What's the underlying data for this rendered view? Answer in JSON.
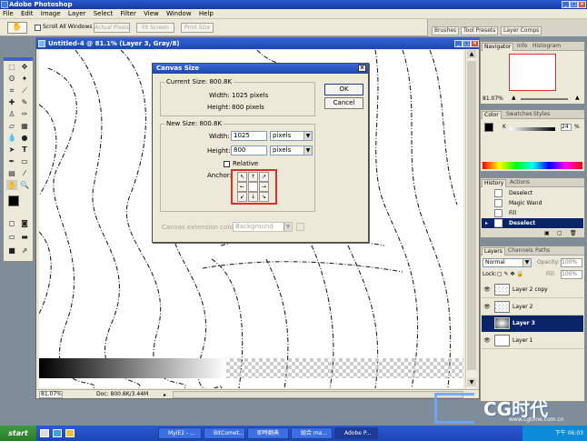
{
  "app": {
    "title": "Adobe Photoshop"
  },
  "menu": [
    "File",
    "Edit",
    "Image",
    "Layer",
    "Select",
    "Filter",
    "View",
    "Window",
    "Help"
  ],
  "options": {
    "scroll_all": "Scroll All Windows",
    "actual_pixels": "Actual Pixels",
    "fit_screen": "Fit Screen",
    "print_size": "Print Size",
    "well_tabs": [
      "Brushes",
      "Tool Presets",
      "Layer Comps"
    ]
  },
  "document": {
    "title": "Untitled-4 @ 81.1% (Layer 3, Gray/8)",
    "zoom": "81.07%",
    "doc_info": "Doc: 800.8K/3.44M"
  },
  "dialog": {
    "title": "Canvas Size",
    "current_size_label": "Current Size: 800.8K",
    "current_width_label": "Width:",
    "current_width_value": "1025 pixels",
    "current_height_label": "Height:",
    "current_height_value": "800 pixels",
    "new_size_label": "New Size: 800.8K",
    "width_label": "Width:",
    "width_value": "1025",
    "width_unit": "pixels",
    "height_label": "Height:",
    "height_value": "800",
    "height_unit": "pixels",
    "relative_label": "Relative",
    "anchor_label": "Anchor:",
    "extension_color_label": "Canvas extension color:",
    "extension_color_value": "Background",
    "ok": "OK",
    "cancel": "Cancel"
  },
  "navigator": {
    "tabs": [
      "Navigator",
      "Info",
      "Histogram"
    ],
    "zoom": "81.07%"
  },
  "color": {
    "tabs": [
      "Color",
      "Swatches",
      "Styles"
    ],
    "channel": "K",
    "value": "24",
    "percent": "%"
  },
  "history": {
    "tabs": [
      "History",
      "Actions"
    ],
    "items": [
      "Deselect",
      "Magic Wand",
      "Fill",
      "Deselect"
    ]
  },
  "layers": {
    "tabs": [
      "Layers",
      "Channels",
      "Paths"
    ],
    "blend_mode": "Normal",
    "opacity_label": "Opacity:",
    "opacity_value": "100%",
    "lock_label": "Lock:",
    "fill_label": "Fill:",
    "fill_value": "100%",
    "items": [
      "Layer 2 copy",
      "Layer 2",
      "Layer 3",
      "Layer 1"
    ]
  },
  "watermark": {
    "text": "CG时代",
    "url": "www.cgtime.com.cn"
  },
  "taskbar": {
    "start": "start",
    "tasks": [
      "",
      "",
      "",
      "MyIE2 - ...",
      "BitComet...",
      "即時翻典",
      "組合 ma...",
      "Adobe P..."
    ],
    "clock": "下午 06:03"
  },
  "colors": {
    "accent": "#1c46ad",
    "selection": "#0a246a",
    "anchor_highlight": "#d8302b"
  }
}
